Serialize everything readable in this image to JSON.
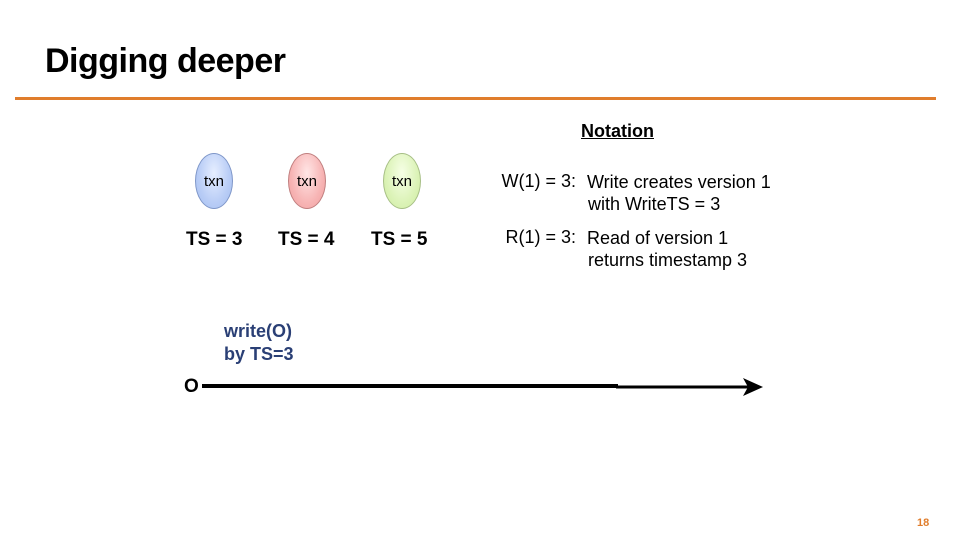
{
  "slide": {
    "title": "Digging deeper",
    "page_number": "18",
    "accent_color": "#e07d2c"
  },
  "transactions": [
    {
      "label": "txn",
      "ts": "TS = 3",
      "color": "#b9cdf6"
    },
    {
      "label": "txn",
      "ts": "TS = 4",
      "color": "#f7b5b5"
    },
    {
      "label": "txn",
      "ts": "TS = 5",
      "color": "#dcf3b8"
    }
  ],
  "notation": {
    "title": "Notation",
    "items": [
      {
        "key": "W(1) = 3:",
        "line1": "Write creates version 1",
        "line2": "with WriteTS = 3"
      },
      {
        "key": "R(1) = 3:",
        "line1": "Read of version 1",
        "line2": "returns timestamp 3"
      }
    ]
  },
  "timeline": {
    "object_label": "O",
    "event_line1": "write(O)",
    "event_line2": "by TS=3",
    "event_color": "#2a3f75"
  }
}
